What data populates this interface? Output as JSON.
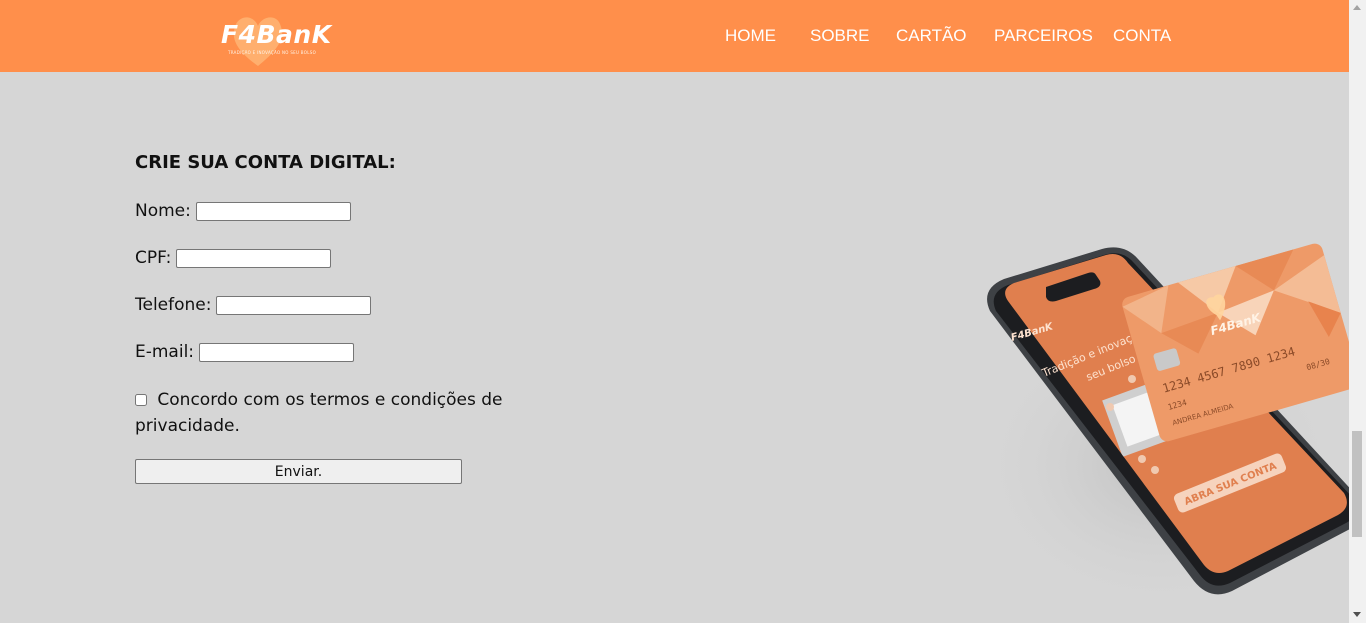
{
  "header": {
    "logo_text": "F4BanK",
    "logo_tagline": "TRADIÇÃO E INOVAÇÃO NO SEU BOLSO",
    "nav": [
      "HOME",
      "SOBRE",
      "CARTÃO",
      "PARCEIROS",
      "CONTA"
    ]
  },
  "form": {
    "title": "CRIE SUA CONTA DIGITAL:",
    "fields": [
      {
        "label": "Nome:",
        "value": ""
      },
      {
        "label": "CPF:",
        "value": ""
      },
      {
        "label": "Telefone:",
        "value": ""
      },
      {
        "label": "E-mail:",
        "value": ""
      }
    ],
    "checkbox_label": "Concordo com os termos e condições de privacidade.",
    "checkbox_checked": false,
    "submit_label": "Enviar."
  },
  "illustration": {
    "phone_text_line1": "Tradição e inovação",
    "phone_text_line2": "seu bolso",
    "phone_logo": "F4BanK",
    "phone_button": "ABRA SUA CONTA",
    "card_logo": "F4BanK",
    "card_number": "1234  4567  7890  1234",
    "card_expiry": "08/30",
    "card_name": "ANDREA ALMEIDA",
    "card_number_small": "1234"
  },
  "colors": {
    "header_bg": "#ff8f4b",
    "page_bg": "#d6d6d6",
    "phone_screen": "#e07f4e",
    "card": "#ef9a68"
  }
}
